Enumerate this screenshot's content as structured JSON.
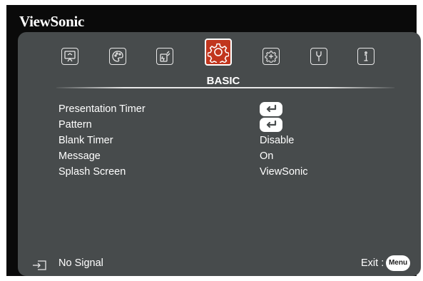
{
  "brand": "ViewSonic",
  "tabs": [
    {
      "name": "display",
      "icon": "display-icon"
    },
    {
      "name": "image-setting",
      "icon": "palette-icon"
    },
    {
      "name": "power-management",
      "icon": "power-plug-icon"
    },
    {
      "name": "basic",
      "icon": "gear-icon",
      "label": "BASIC",
      "active": true
    },
    {
      "name": "advanced",
      "icon": "advanced-gear-icon"
    },
    {
      "name": "system",
      "icon": "wrench-icon"
    },
    {
      "name": "information",
      "icon": "info-icon"
    }
  ],
  "active_tab_label": "BASIC",
  "menu": [
    {
      "label": "Presentation Timer",
      "value_type": "enter"
    },
    {
      "label": "Pattern",
      "value_type": "enter"
    },
    {
      "label": "Blank Timer",
      "value": "Disable"
    },
    {
      "label": "Message",
      "value": "On"
    },
    {
      "label": "Splash Screen",
      "value": "ViewSonic"
    }
  ],
  "footer": {
    "signal_icon": "input-source-icon",
    "signal_text": "No Signal",
    "exit_text": "Exit :",
    "menu_button": "Menu"
  },
  "colors": {
    "panel": "#474b4c",
    "active_tab": "#c1361e",
    "frame": "#0a0a0a"
  }
}
